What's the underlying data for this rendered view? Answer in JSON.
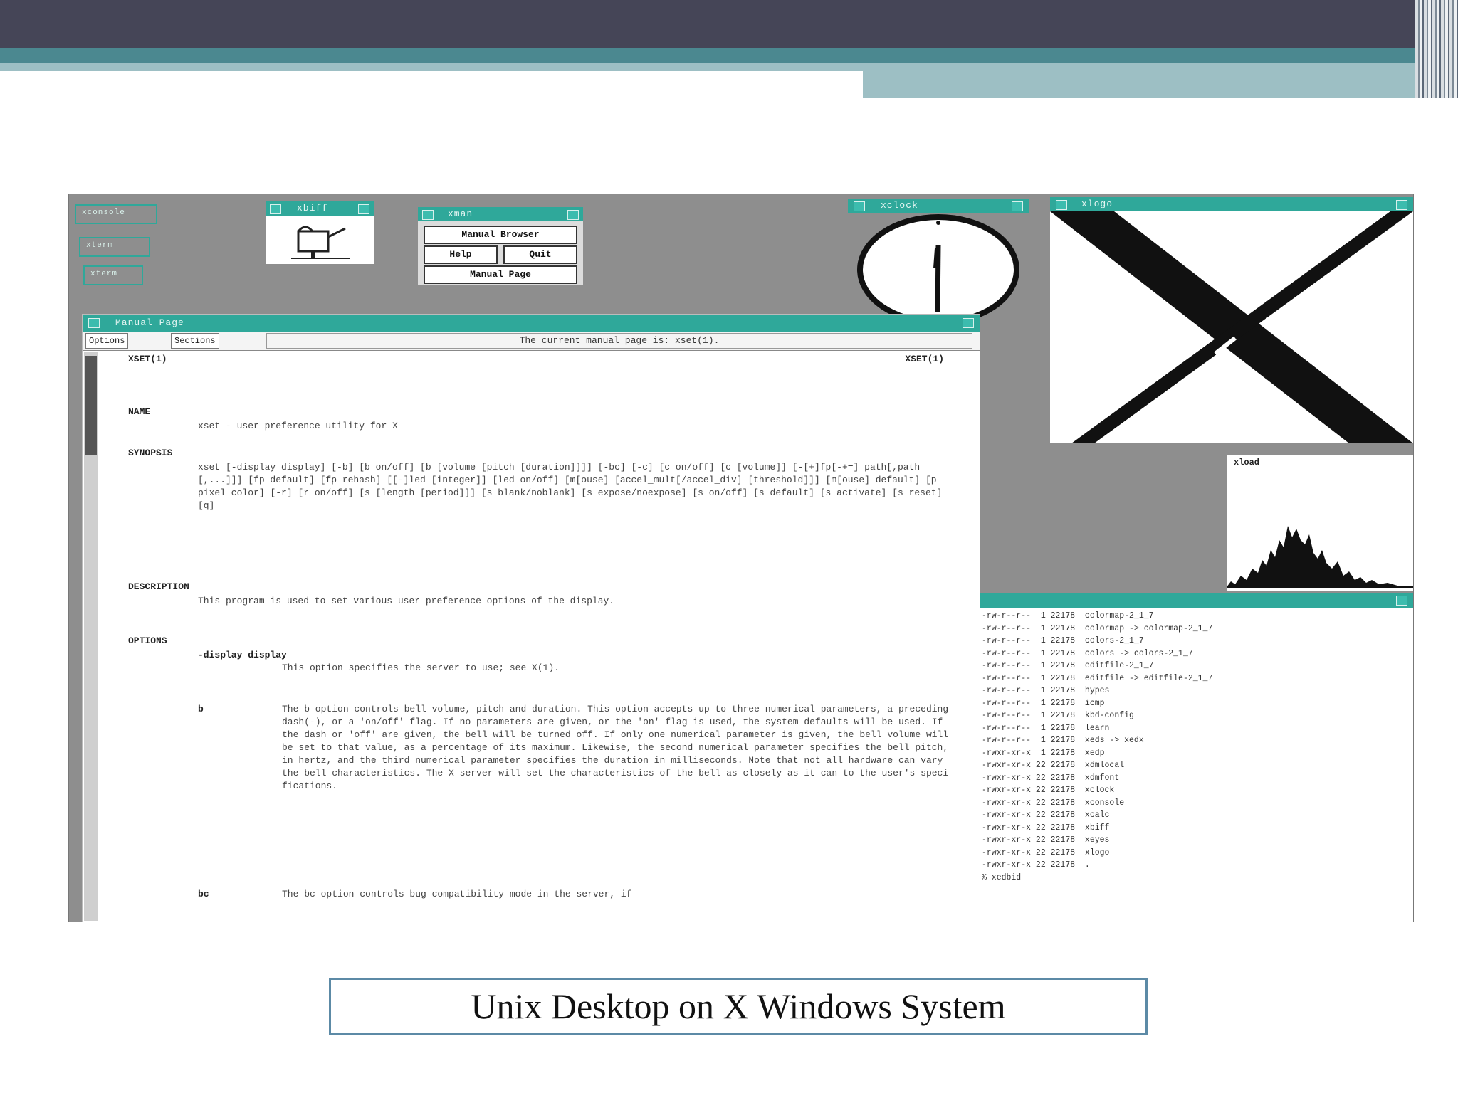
{
  "caption": "Unix Desktop on X Windows System",
  "desktop": {
    "icons": [
      "xconsole",
      "xterm",
      "xterm"
    ],
    "xbiff_title": "xbiff",
    "xman": {
      "title": "xman",
      "buttons": [
        "Manual Browser",
        "Help",
        "Quit",
        "Manual Page"
      ]
    },
    "xclock_title": "xclock",
    "xlogo_title": "xlogo",
    "xload_title": "xload",
    "manual_page": {
      "title": "Manual Page",
      "menu_options": "Options",
      "menu_sections": "Sections",
      "message": "The current manual page is: xset(1).",
      "header_left": "XSET(1)",
      "header_right": "XSET(1)",
      "name_heading": "NAME",
      "name_text": "xset - user preference utility for X",
      "synopsis_heading": "SYNOPSIS",
      "synopsis_text": "xset [-display display] [-b] [b on/off] [b [volume [pitch [duration]]]] [-bc] [-c] [c on/off] [c [volume]] [-[+]fp[-+=] path[,path[,...]]] [fp default] [fp rehash] [[-]led [integer]] [led on/off] [m[ouse] [accel_mult[/accel_div] [threshold]]] [m[ouse] default] [p pixel color] [-r] [r on/off] [s [length [period]]] [s blank/noblank] [s expose/noexpose] [s on/off] [s default] [s activate] [s reset] [q]",
      "description_heading": "DESCRIPTION",
      "description_text": "This program is used to set various user preference options of the display.",
      "options_heading": "OPTIONS",
      "opt_display_flag": "-display display",
      "opt_display_text": "This option specifies the server to use; see X(1).",
      "opt_b_flag": "b",
      "opt_b_text": "The b option controls bell volume, pitch and duration. This option accepts up to three numerical parameters, a preceding dash(-), or a 'on/off' flag. If no parameters are given, or the 'on' flag is used, the system defaults will be used. If the dash or 'off' are given, the bell will be turned off. If only one numerical parameter is given, the bell volume will be set to that value, as a percentage of its maximum. Likewise, the second numerical parameter specifies the bell pitch, in hertz, and the third numerical parameter specifies the duration in milliseconds. Note that not all hardware can vary the bell characteristics. The X server will set the characteristics of the bell as closely as it can to the user's specifications.",
      "opt_bc_flag": "bc",
      "opt_bc_text": "The bc option controls bug compatibility mode in the server, if"
    },
    "terminal": {
      "lines": [
        "-rw-r--r--  1 22178  colormap-2_1_7",
        "-rw-r--r--  1 22178  colormap -> colormap-2_1_7",
        "-rw-r--r--  1 22178  colors-2_1_7",
        "-rw-r--r--  1 22178  colors -> colors-2_1_7",
        "-rw-r--r--  1 22178  editfile-2_1_7",
        "-rw-r--r--  1 22178  editfile -> editfile-2_1_7",
        "-rw-r--r--  1 22178  hypes",
        "-rw-r--r--  1 22178  icmp",
        "-rw-r--r--  1 22178  kbd-config",
        "-rw-r--r--  1 22178  learn",
        "-rw-r--r--  1 22178  xeds -> xedx",
        "-rwxr-xr-x  1 22178  xedp",
        "-rwxr-xr-x 22 22178  xdmlocal",
        "-rwxr-xr-x 22 22178  xdmfont",
        "-rwxr-xr-x 22 22178  xclock",
        "-rwxr-xr-x 22 22178  xconsole",
        "-rwxr-xr-x 22 22178  xcalc",
        "-rwxr-xr-x 22 22178  xbiff",
        "-rwxr-xr-x 22 22178  xeyes",
        "-rwxr-xr-x 22 22178  xlogo",
        "-rwxr-xr-x 22 22178  .",
        "% xedbid"
      ]
    }
  }
}
